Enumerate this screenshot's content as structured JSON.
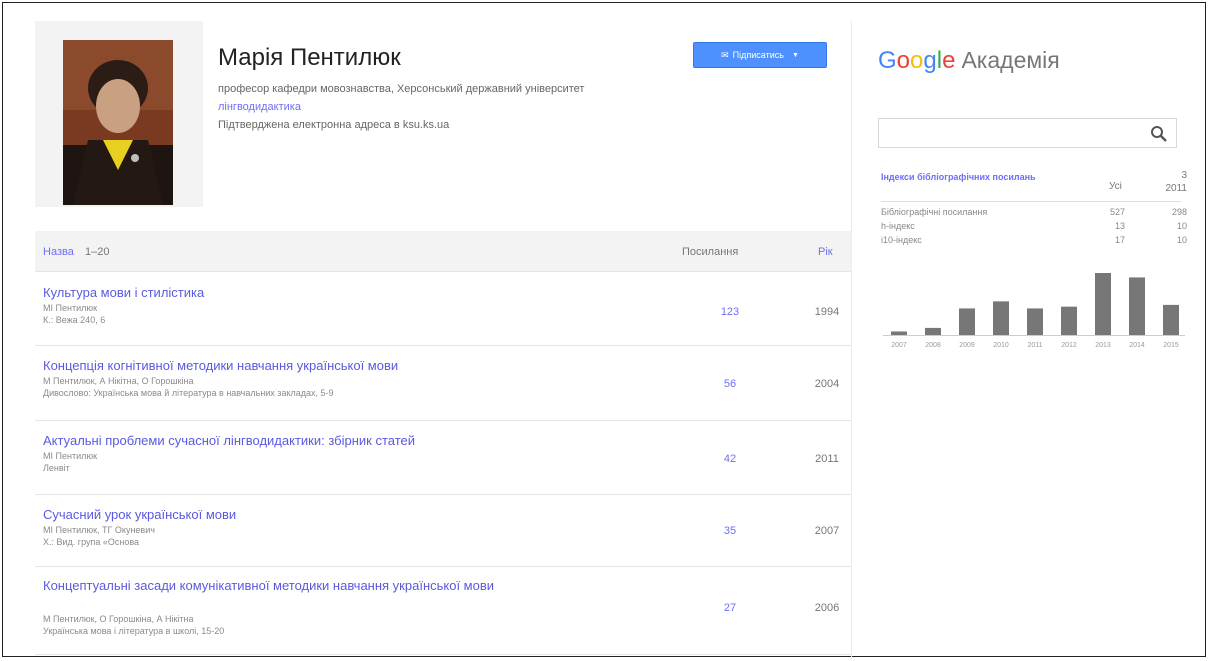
{
  "profile": {
    "name": "Марія Пентилюк",
    "affiliation": "професор кафедри мовознавства, Херсонський державний університет",
    "interest": "лінгводидактика",
    "email": "Підтверджена електронна адреса в ksu.ks.ua",
    "follow_label": "Підписатись"
  },
  "table": {
    "header_title": "Назва",
    "header_range": "1–20",
    "header_cited": "Посилання",
    "header_year": "Рік",
    "rows": [
      {
        "title": "Культура мови і стилістика",
        "authors": "МІ Пентилюк",
        "venue": "К.: Вежа 240, 6",
        "cited": "123",
        "year": "1994"
      },
      {
        "title": "Концепція когнітивної методики навчання української мови",
        "authors": "М Пентилюк, А Нікітна, О Горошкіна",
        "venue": "Дивослово: Українська мова й література в навчальних закладах, 5-9",
        "cited": "56",
        "year": "2004"
      },
      {
        "title": "Актуальні проблеми сучасної лінгводидактики: збірник статей",
        "authors": "МІ Пентилюк",
        "venue": "Ленвіт",
        "cited": "42",
        "year": "2011"
      },
      {
        "title": "Сучасний урок української мови",
        "authors": "МІ Пентилюк, ТГ Окуневич",
        "venue": "Х.: Вид. група «Основа",
        "cited": "35",
        "year": "2007"
      },
      {
        "title": "Концептуальні засади комунікативної методики навчання української мови",
        "authors": "М Пентилюк, О Горошкіна, А Нікітна",
        "venue": "Українська мова і література в школі, 15-20",
        "cited": "27",
        "year": "2006"
      }
    ]
  },
  "sidebar": {
    "logo_suffix": "Академія",
    "search_placeholder": "",
    "citations": {
      "title": "Індекси бібліографічних посилань",
      "col_all": "Усі",
      "col_since_n": "3",
      "col_since_year": "2011",
      "rows": [
        {
          "label": "Бібліографічні посилання",
          "all": "527",
          "since": "298"
        },
        {
          "label": "h-індекс",
          "all": "13",
          "since": "10"
        },
        {
          "label": "i10-індекс",
          "all": "17",
          "since": "10"
        }
      ]
    }
  },
  "chart_data": {
    "type": "bar",
    "categories": [
      "2007",
      "2008",
      "2009",
      "2010",
      "2011",
      "2012",
      "2013",
      "2014",
      "2015"
    ],
    "values": [
      4,
      8,
      30,
      38,
      30,
      32,
      70,
      65,
      34
    ],
    "bar_color": "#777777"
  },
  "colors": {
    "link": "#6e6ef6",
    "button": "#4d90fe"
  }
}
